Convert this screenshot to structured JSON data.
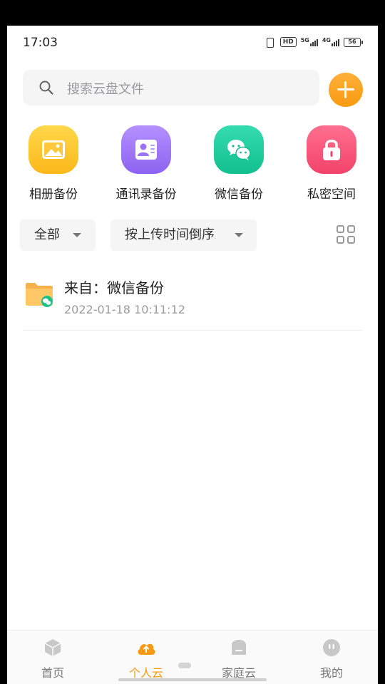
{
  "status_bar": {
    "time": "17:03",
    "hd_label": "HD",
    "net_5g": "5G",
    "net_4g": "4G",
    "battery": "56"
  },
  "search": {
    "placeholder": "搜索云盘文件"
  },
  "quick_entries": [
    {
      "label": "相册备份",
      "icon": "photo-album-icon",
      "color": "#fbb81a"
    },
    {
      "label": "通讯录备份",
      "icon": "contacts-icon",
      "color": "#8c63f0"
    },
    {
      "label": "微信备份",
      "icon": "wechat-icon",
      "color": "#12bf8e"
    },
    {
      "label": "私密空间",
      "icon": "lock-icon",
      "color": "#f2436a"
    }
  ],
  "filters": {
    "category": "全部",
    "sort": "按上传时间倒序"
  },
  "files": [
    {
      "name": "来自：微信备份",
      "time": "2022-01-18 10:11:12",
      "icon": "wechat-folder-icon"
    }
  ],
  "bottom_nav": [
    {
      "label": "首页",
      "icon": "cube-icon",
      "active": false
    },
    {
      "label": "个人云",
      "icon": "cloud-upload-icon",
      "active": true
    },
    {
      "label": "家庭云",
      "icon": "home-cloud-icon",
      "active": false
    },
    {
      "label": "我的",
      "icon": "profile-face-icon",
      "active": false
    }
  ],
  "colors": {
    "accent": "#f59a12",
    "background": "#ffffff",
    "chip_background": "#f5f5f6"
  }
}
